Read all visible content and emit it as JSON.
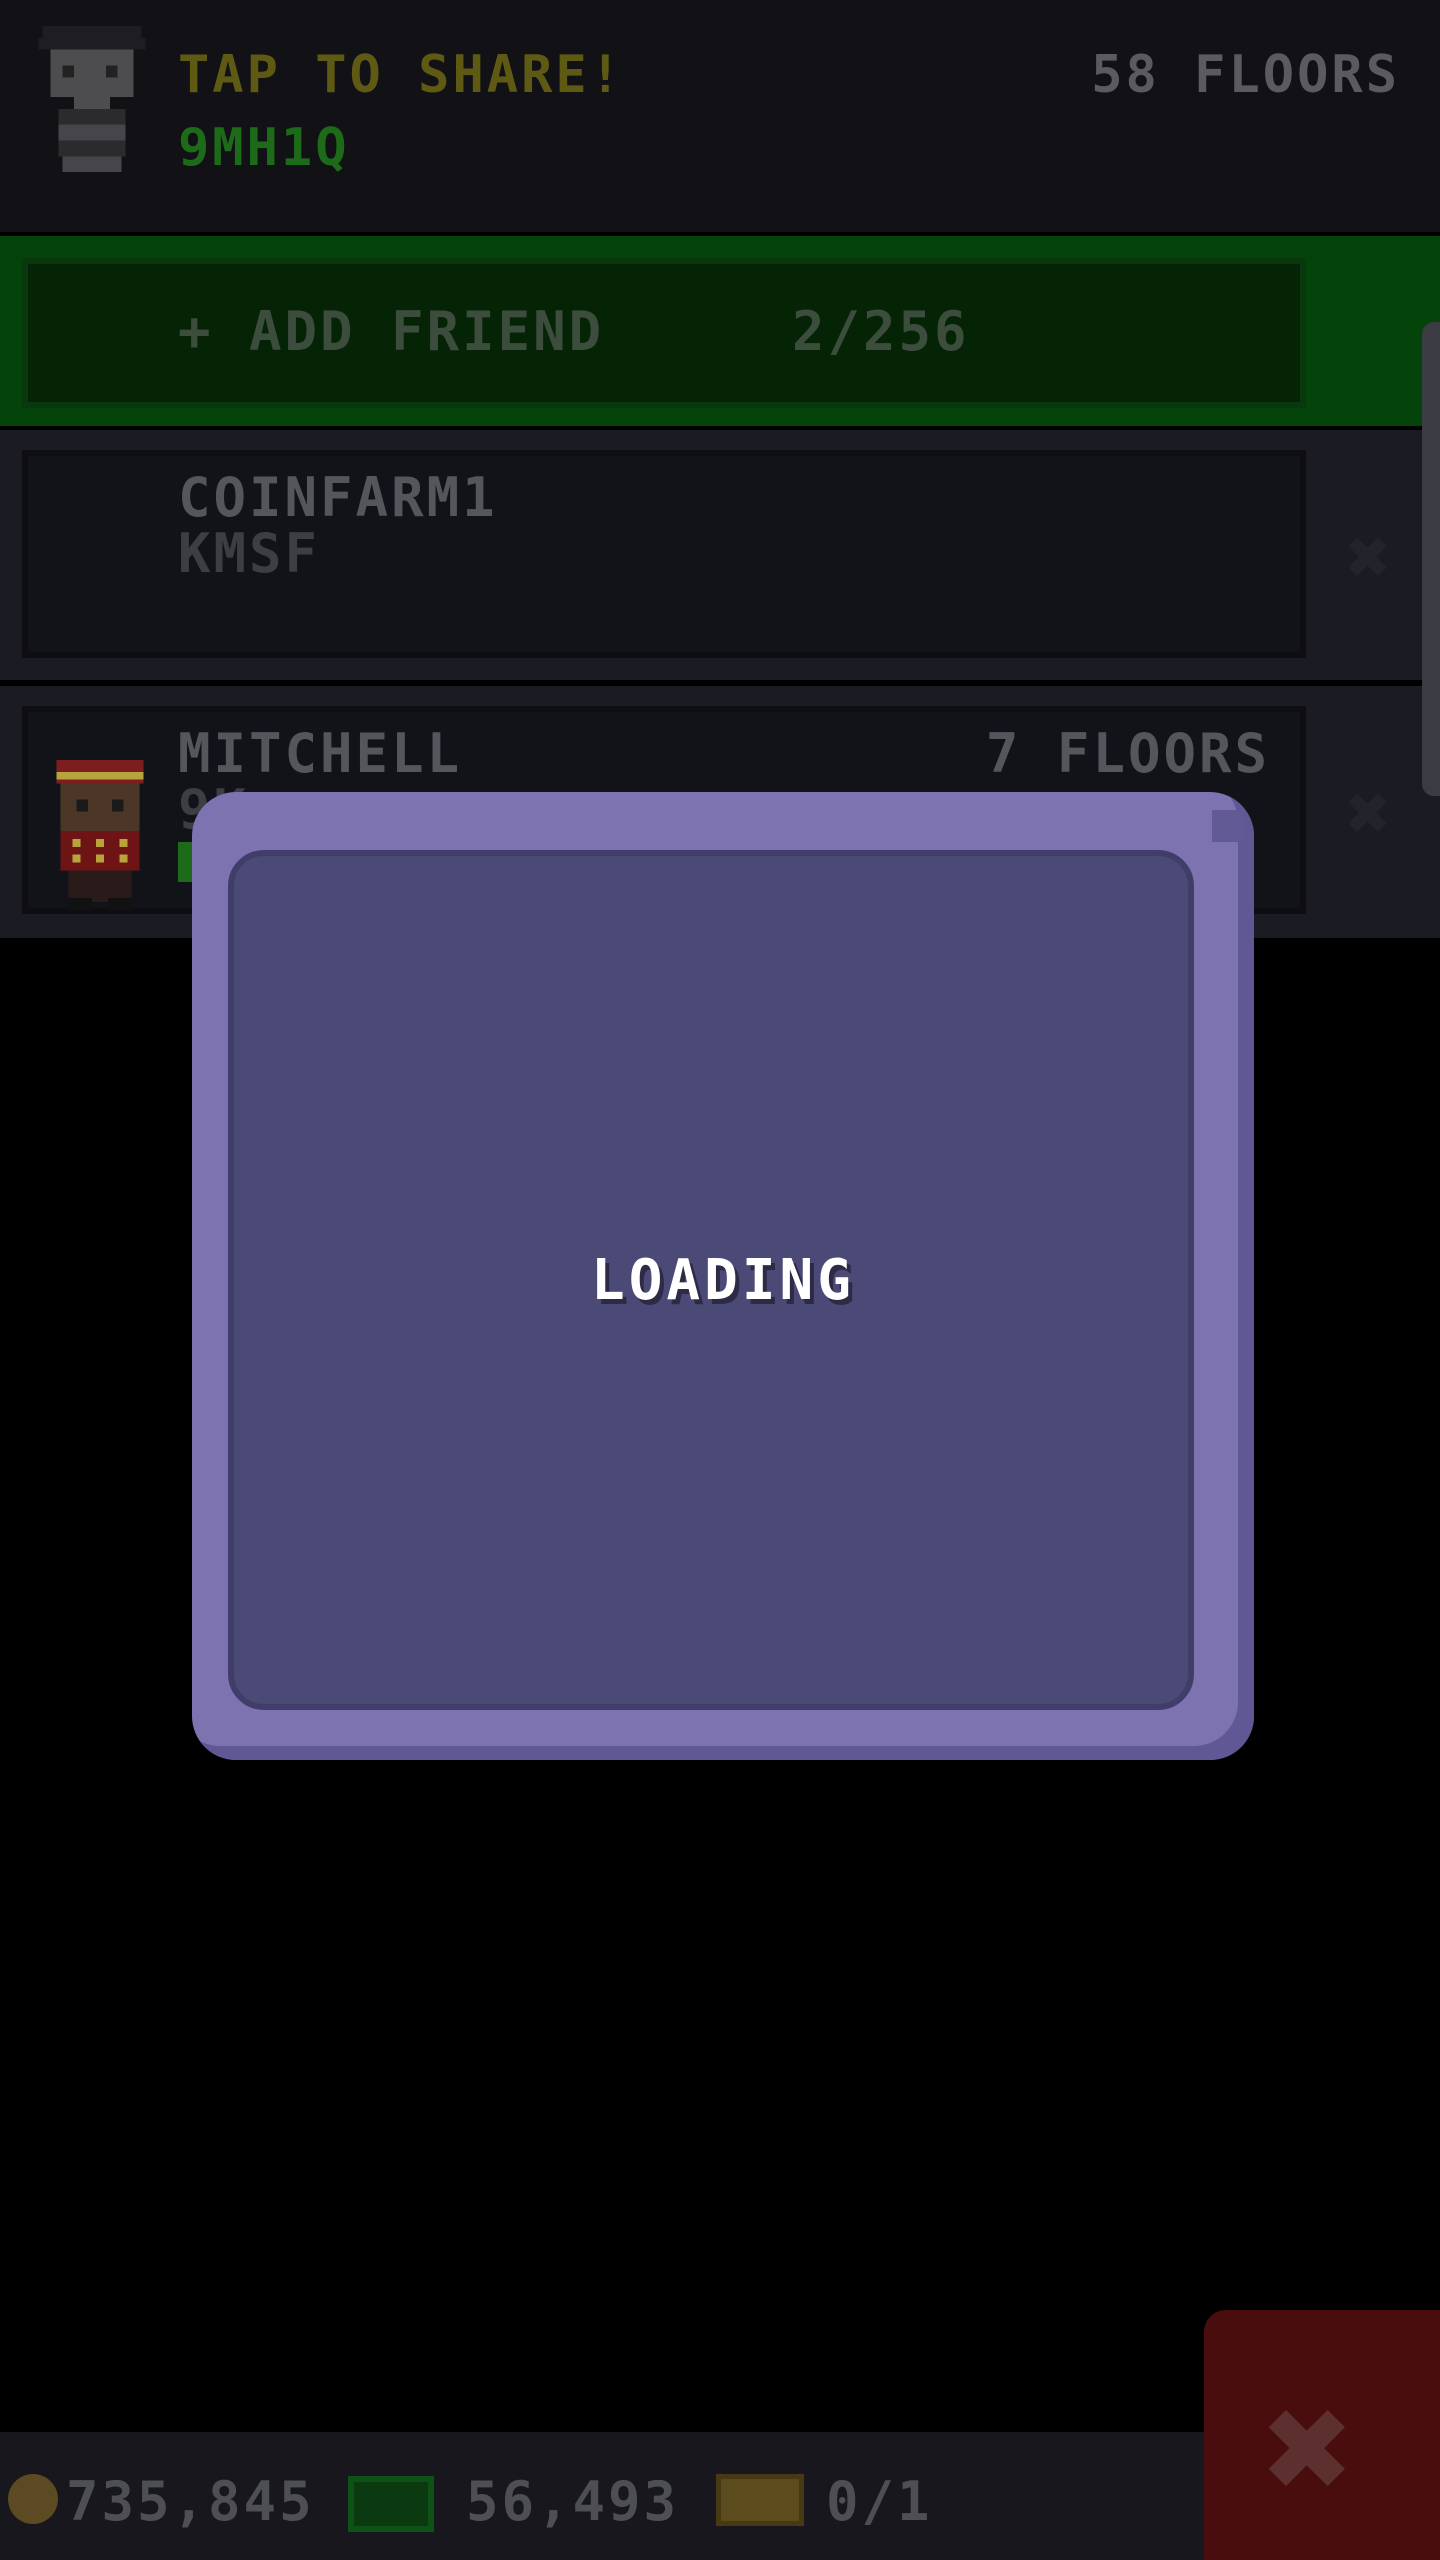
{
  "header": {
    "share_label": "TAP TO SHARE!",
    "share_code": "9MH1Q",
    "floors": "58 FLOORS"
  },
  "add_friend": {
    "label": "+ ADD FRIEND",
    "count": "2/256"
  },
  "friends": [
    {
      "name": "COINFARM1",
      "code": "KMSF",
      "remove_icon": "close-icon"
    },
    {
      "name": "MITCHELL",
      "code": "9K...",
      "floors": "7 FLOORS",
      "remove_icon": "close-icon"
    }
  ],
  "modal": {
    "text": "LOADING"
  },
  "bottom_bar": {
    "coins": "735,845",
    "bux": "56,493",
    "tickets": "0/1",
    "close_icon": "close-icon"
  },
  "colors": {
    "modal_outer": "#7c73b0",
    "modal_inner": "#4b4976",
    "add_band": "#04430a",
    "close_button": "#4a0d0d"
  }
}
